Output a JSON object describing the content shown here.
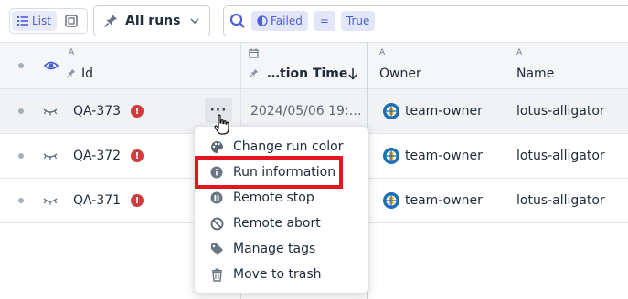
{
  "toolbar": {
    "view_list_label": "List",
    "view_list_icon": "list-icon",
    "view_grid_icon": "grid-icon",
    "runs_button_label": "All runs",
    "runs_button_icon": "pin-icon",
    "search_icon": "search-icon",
    "filter_chips": [
      {
        "label": "Failed",
        "icon": "half-circle-icon"
      },
      {
        "label": "="
      },
      {
        "label": "True"
      }
    ]
  },
  "table": {
    "columns": [
      {
        "label": "Id",
        "type_marker": "A",
        "icon": "pin-icon"
      },
      {
        "label": "…tion Time",
        "icon": "pin-icon",
        "sort": "descending"
      },
      {
        "label": "Owner",
        "type_marker": "A"
      },
      {
        "label": "Name",
        "type_marker": "A"
      }
    ],
    "rows": [
      {
        "id": "QA-373",
        "status": "!",
        "time": "2024/05/06 19:…",
        "owner": "team-owner",
        "name": "lotus-alligator",
        "hovered": true
      },
      {
        "id": "QA-372",
        "status": "!",
        "time": "",
        "owner": "team-owner",
        "name": "lotus-alligator",
        "hovered": false
      },
      {
        "id": "QA-371",
        "status": "!",
        "time": "",
        "owner": "team-owner",
        "name": "lotus-alligator",
        "hovered": false
      }
    ],
    "row_menu_label": "···"
  },
  "context_menu": {
    "items": [
      {
        "label": "Change run color",
        "icon": "palette-icon"
      },
      {
        "label": "Run information",
        "icon": "info-icon",
        "highlighted": true
      },
      {
        "label": "Remote stop",
        "icon": "pause-icon"
      },
      {
        "label": "Remote abort",
        "icon": "abort-icon"
      },
      {
        "label": "Manage tags",
        "icon": "tag-icon"
      },
      {
        "label": "Move to trash",
        "icon": "trash-icon"
      }
    ]
  },
  "colors": {
    "accent": "#4c5fd6",
    "failed": "#d13b3b",
    "highlight": "#e3151d"
  }
}
